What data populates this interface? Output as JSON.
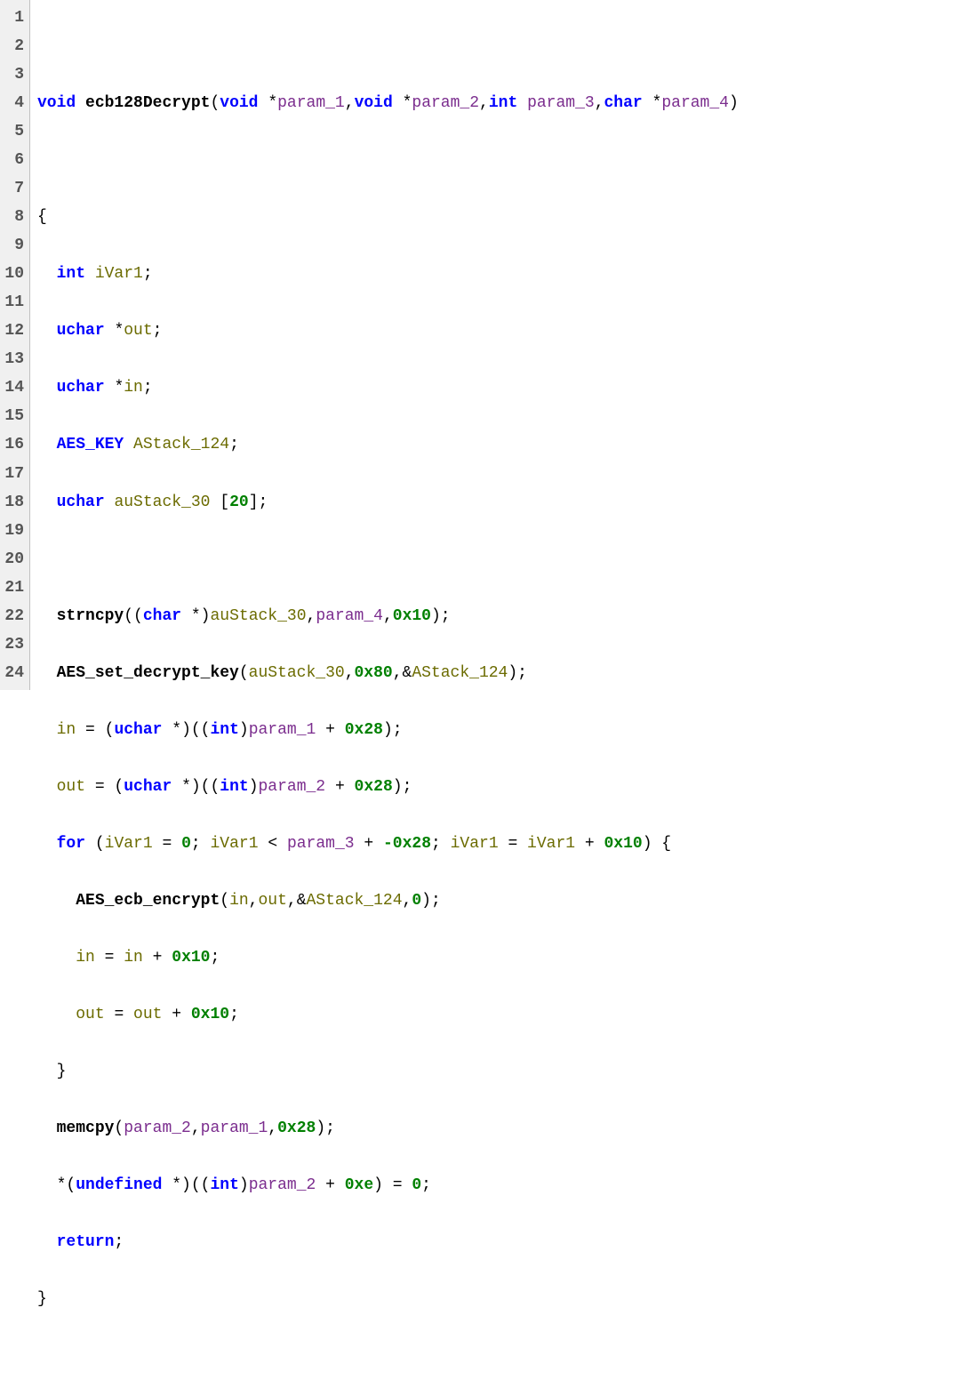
{
  "gutter": {
    "lines": [
      "1",
      "2",
      "3",
      "4",
      "5",
      "6",
      "7",
      "8",
      "9",
      "10",
      "11",
      "12",
      "13",
      "14",
      "15",
      "16",
      "17",
      "18",
      "19",
      "20",
      "21",
      "22",
      "23",
      "24"
    ]
  },
  "code": {
    "sig": {
      "ret": "void",
      "name": "ecb128Decrypt",
      "p1t": "void",
      "p1n": "param_1",
      "p2t": "void",
      "p2n": "param_2",
      "p3t": "int",
      "p3n": "param_3",
      "p4t": "char",
      "p4n": "param_4"
    },
    "decl": {
      "int": "int",
      "ivar1": "iVar1",
      "uchar": "uchar",
      "out": "out",
      "in": "in",
      "aeskey": "AES_KEY",
      "astack": "AStack_124",
      "austack": "auStack_30",
      "arr20": "20"
    },
    "body": {
      "strncpy": "strncpy",
      "char": "char",
      "hex10": "0x10",
      "aes_set": "AES_set_decrypt_key",
      "hex80": "0x80",
      "int": "int",
      "hex28": "0x28",
      "for": "for",
      "zero": "0",
      "neg28": "-0x28",
      "aes_ecb": "AES_ecb_encrypt",
      "memcpy": "memcpy",
      "undef": "undefined",
      "hexe": "0xe",
      "return": "return"
    }
  }
}
